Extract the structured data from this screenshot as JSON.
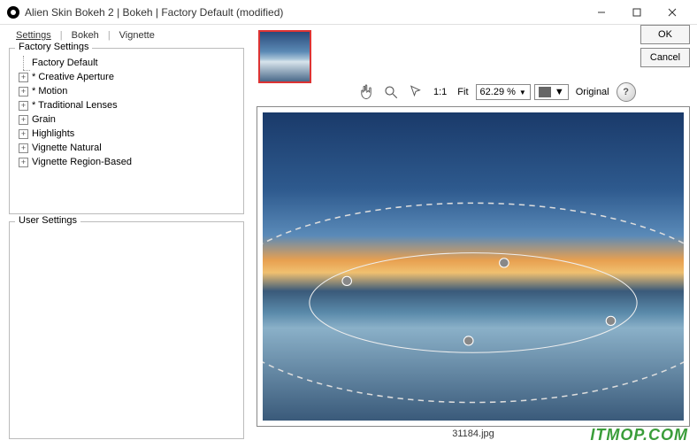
{
  "window": {
    "title": "Alien Skin Bokeh 2 | Bokeh | Factory Default (modified)",
    "minimize": "—",
    "maximize": "☐",
    "close": "✕"
  },
  "tabs": {
    "settings": "Settings",
    "bokeh": "Bokeh",
    "vignette": "Vignette"
  },
  "buttons": {
    "ok": "OK",
    "cancel": "Cancel"
  },
  "factory": {
    "legend": "Factory Settings",
    "items": [
      {
        "label": "Factory Default",
        "expandable": false
      },
      {
        "label": "* Creative Aperture",
        "expandable": true
      },
      {
        "label": "* Motion",
        "expandable": true
      },
      {
        "label": "* Traditional Lenses",
        "expandable": true
      },
      {
        "label": "Grain",
        "expandable": true
      },
      {
        "label": "Highlights",
        "expandable": true
      },
      {
        "label": "Vignette Natural",
        "expandable": true
      },
      {
        "label": "Vignette Region-Based",
        "expandable": true
      }
    ]
  },
  "user": {
    "legend": "User Settings"
  },
  "toolbar": {
    "one_to_one": "1:1",
    "fit": "Fit",
    "zoom": "62.29 %",
    "original": "Original"
  },
  "filename": "31184.jpg",
  "watermark": "ITMOP.COM"
}
